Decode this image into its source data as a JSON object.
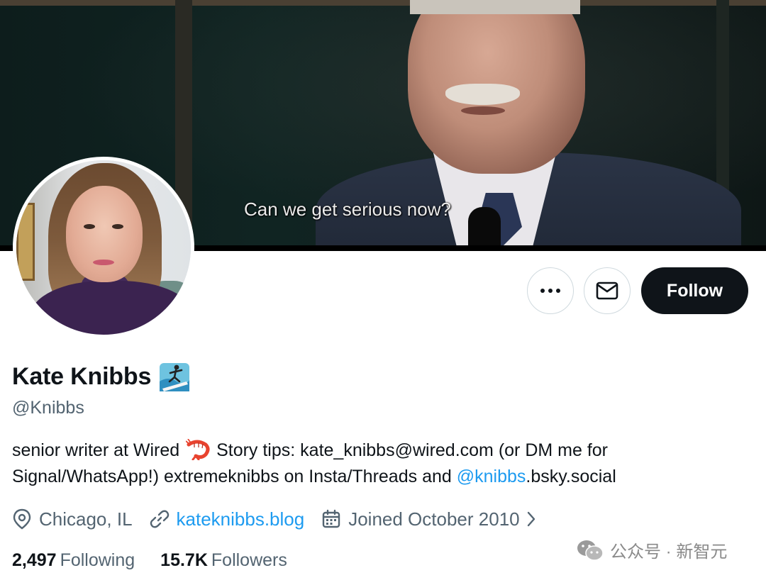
{
  "banner": {
    "subtitle": "Can we get serious now?"
  },
  "actions": {
    "follow_label": "Follow",
    "more_icon": "more-horizontal-icon",
    "message_icon": "envelope-icon"
  },
  "profile": {
    "display_name": "Kate Knibbs",
    "name_emoji": "surfer-icon",
    "handle": "@Knibbs",
    "bio": {
      "part1": "senior writer at Wired",
      "emoji": "shrimp-icon",
      "part2": " Story tips: kate_knibbs@wired.com (or DM me for Signal/WhatsApp!) extremeknibbs on Insta/Threads and ",
      "mention": "@knibbs",
      "part3": ".bsky.social"
    },
    "location": "Chicago, IL",
    "website": "kateknibbs.blog",
    "joined": "Joined October 2010"
  },
  "stats": {
    "following_count": "2,497",
    "following_label": "Following",
    "followers_count": "15.7K",
    "followers_label": "Followers"
  },
  "watermark": {
    "text": "公众号 · 新智元"
  },
  "colors": {
    "accent": "#1d9bf0",
    "text_primary": "#0f1419",
    "text_secondary": "#536471",
    "border": "#cfd9de"
  }
}
